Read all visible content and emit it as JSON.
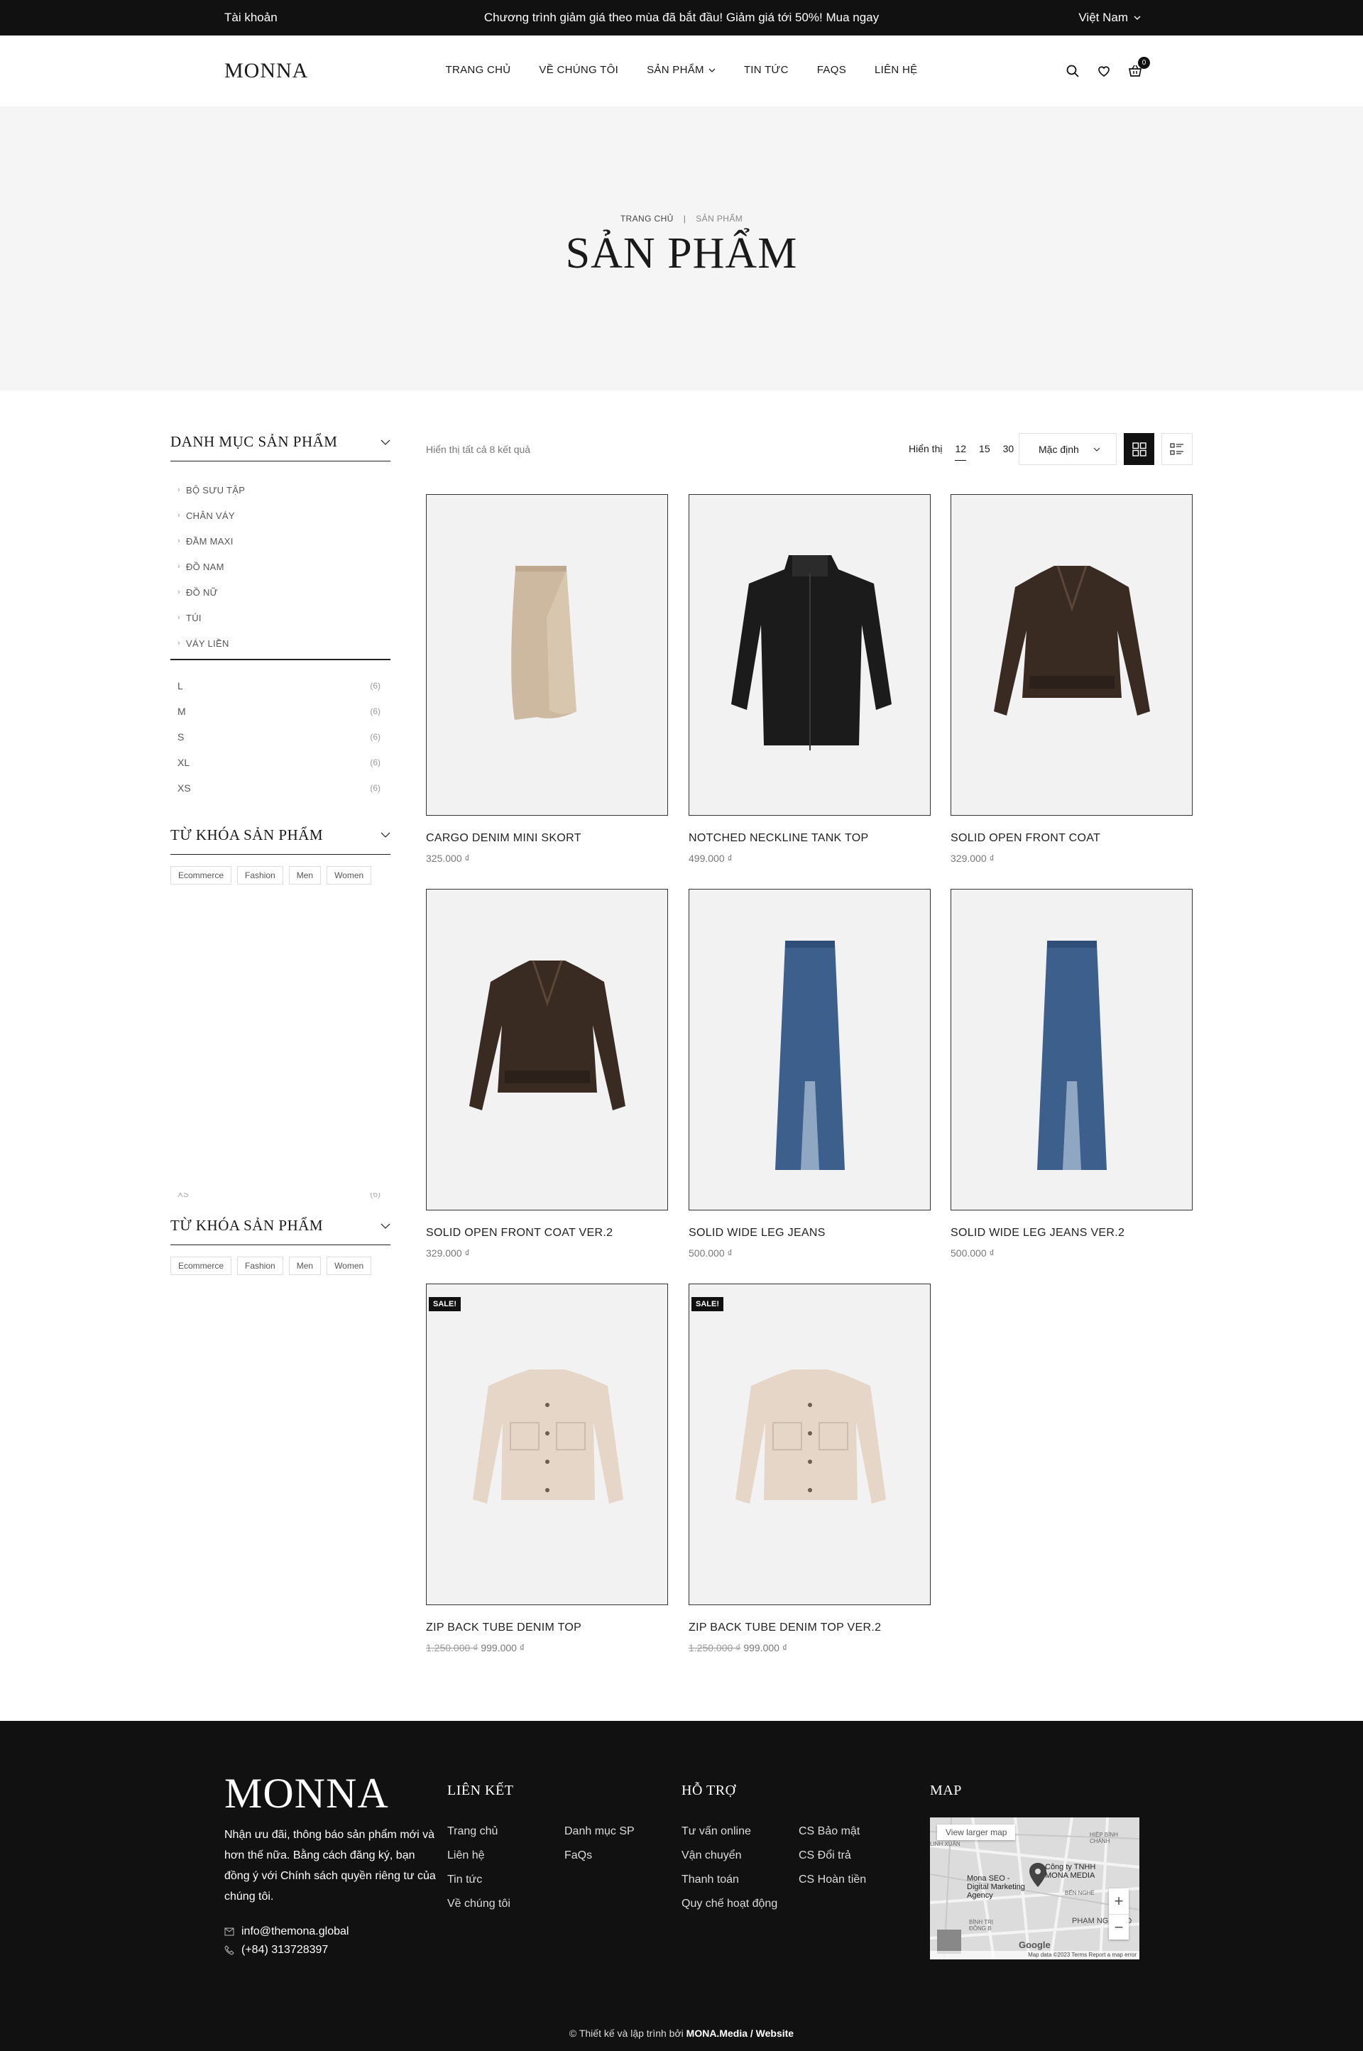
{
  "topbar": {
    "account": "Tài khoản",
    "promo": "Chương trình giảm giá theo mùa đã bắt đầu! Giảm giá tới 50%! Mua ngay",
    "language": "Việt Nam"
  },
  "header": {
    "logo": "MONNA",
    "nav": [
      "TRANG CHỦ",
      "VỀ CHÚNG TÔI",
      "SẢN PHẨM",
      "TIN TỨC",
      "FAQS",
      "LIÊN HỆ"
    ],
    "cart_count": "0"
  },
  "hero": {
    "breadcrumb_home": "TRANG CHỦ",
    "breadcrumb_current": "SẢN PHẨM",
    "title": "SẢN PHẨM"
  },
  "sidebar": {
    "category_title": "DANH MỤC SẢN PHẨM",
    "categories": [
      "BỘ SƯU TẬP",
      "CHÂN VÁY",
      "ĐẦM MAXI",
      "ĐỒ NAM",
      "ĐỒ NỮ",
      "TÚI",
      "VÁY LIỀN"
    ],
    "sizes": [
      {
        "label": "L",
        "count": "(6)"
      },
      {
        "label": "M",
        "count": "(6)"
      },
      {
        "label": "S",
        "count": "(6)"
      },
      {
        "label": "XL",
        "count": "(6)"
      },
      {
        "label": "XS",
        "count": "(6)"
      }
    ],
    "tag_title": "TỪ KHÓA SẢN PHẨM",
    "tags": [
      "Ecommerce",
      "Fashion",
      "Men",
      "Women"
    ]
  },
  "toolbar": {
    "result_text": "Hiển thị tất cả 8 kết quả",
    "show_label": "Hiển thị",
    "per_page": [
      "12",
      "15",
      "30"
    ],
    "sort_value": "Mặc định"
  },
  "products": [
    {
      "name": "CARGO DENIM MINI SKORT",
      "price": "325.000 ₫",
      "old_price": "",
      "sale": ""
    },
    {
      "name": "NOTCHED NECKLINE TANK TOP",
      "price": "499.000 ₫",
      "old_price": "",
      "sale": ""
    },
    {
      "name": "SOLID OPEN FRONT COAT",
      "price": "329.000 ₫",
      "old_price": "",
      "sale": ""
    },
    {
      "name": "SOLID OPEN FRONT COAT VER.2",
      "price": "329.000 ₫",
      "old_price": "",
      "sale": ""
    },
    {
      "name": "SOLID WIDE LEG JEANS",
      "price": "500.000 ₫",
      "old_price": "",
      "sale": ""
    },
    {
      "name": "SOLID WIDE LEG JEANS VER.2",
      "price": "500.000 ₫",
      "old_price": "",
      "sale": ""
    },
    {
      "name": "ZIP BACK TUBE DENIM TOP",
      "price": "999.000 ₫",
      "old_price": "1.250.000 ₫",
      "sale": "SALE!"
    },
    {
      "name": "ZIP BACK TUBE DENIM TOP VER.2",
      "price": "999.000 ₫",
      "old_price": "1.250.000 ₫",
      "sale": "SALE!"
    }
  ],
  "footer": {
    "logo": "MONNA",
    "description": "Nhận ưu đãi, thông báo sản phẩm mới và hơn thế nữa. Bằng cách đăng ký, bạn đồng ý với Chính sách quyền riêng tư của chúng tôi.",
    "email": "info@themona.global",
    "phone": "(+84) 313728397",
    "links_title": "LIÊN KẾT",
    "links_col1": [
      "Trang chủ",
      "Liên hệ",
      "Tin tức",
      "Về chúng tôi"
    ],
    "links_col2": [
      "Danh mục SP",
      "FaQs"
    ],
    "support_title": "HỖ TRỢ",
    "support_col1": [
      "Tư vấn online",
      "Vận chuyển",
      "Thanh toán",
      "Quy chế hoạt động"
    ],
    "support_col2": [
      "CS Bảo mật",
      "CS Đổi trả",
      "CS Hoàn tiền"
    ],
    "map_title": "MAP",
    "map": {
      "view_larger": "View larger map",
      "place": "Công ty TNHH MONA MEDIA",
      "place2": "Mona SEO - Digital Marketing Agency",
      "area1": "HIỆP BÌNH CHÁNH",
      "area2": "PHẠM NGŨ LÃO",
      "area3": "BÌNH TRỊ ĐÔNG B",
      "area4": "LINH XUÂN",
      "area5": "BẾN NGHÉ",
      "attribution": "Map data ©2023   Terms   Report a map error",
      "google": "Google"
    },
    "copyright_prefix": "© Thiết kế và lập trình bởi",
    "copyright_brand": "MONA.Media / Website"
  },
  "colors": {
    "dark": "#111111",
    "hero_bg": "#f5f5f5",
    "muted": "#777777"
  },
  "icons": [
    "chevron-down-icon",
    "search-icon",
    "heart-icon",
    "cart-icon",
    "grid-view-icon",
    "list-view-icon",
    "mail-icon",
    "phone-icon"
  ]
}
